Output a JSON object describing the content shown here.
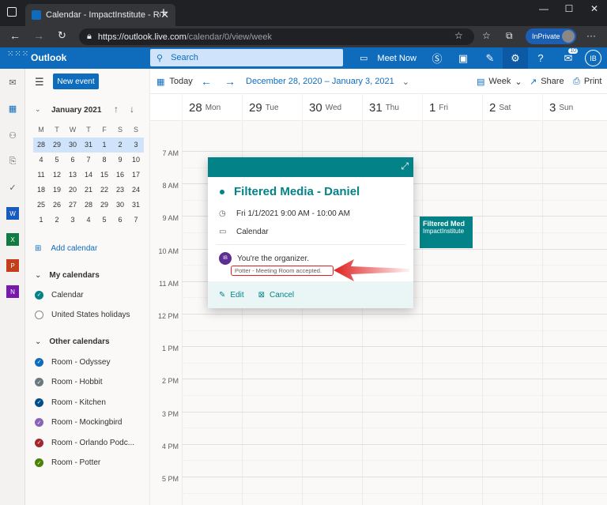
{
  "browser": {
    "tab_title": "Calendar - ImpactInstitute - Roo",
    "tab_close": "✕",
    "new_tab": "+",
    "url_host": "https://outlook.live.com",
    "url_path": "/calendar/0/view/week",
    "inprivate": "InPrivate",
    "menu": "···"
  },
  "header": {
    "app_name": "Outlook",
    "search_placeholder": "Search",
    "meet_now": "Meet Now",
    "badge_count": "10",
    "avatar": "IB",
    "help": "?"
  },
  "sidebar": {
    "new_event": "New event",
    "month_label": "January 2021",
    "weekday_headers": [
      "M",
      "T",
      "W",
      "T",
      "F",
      "S",
      "S"
    ],
    "weeks": [
      [
        "28",
        "29",
        "30",
        "31",
        "1",
        "2",
        "3"
      ],
      [
        "4",
        "5",
        "6",
        "7",
        "8",
        "9",
        "10"
      ],
      [
        "11",
        "12",
        "13",
        "14",
        "15",
        "16",
        "17"
      ],
      [
        "18",
        "19",
        "20",
        "21",
        "22",
        "23",
        "24"
      ],
      [
        "25",
        "26",
        "27",
        "28",
        "29",
        "30",
        "31"
      ],
      [
        "1",
        "2",
        "3",
        "4",
        "5",
        "6",
        "7"
      ]
    ],
    "add_calendar": "Add calendar",
    "my_calendars_title": "My calendars",
    "my_calendars": [
      {
        "label": "Calendar",
        "color": "#038387",
        "checked": true
      },
      {
        "label": "United States holidays",
        "color": "#ffffff",
        "checked": false
      }
    ],
    "other_calendars_title": "Other calendars",
    "other_calendars": [
      {
        "label": "Room - Odyssey",
        "color": "#0f6cbd",
        "checked": true
      },
      {
        "label": "Room - Hobbit",
        "color": "#69797e",
        "checked": true
      },
      {
        "label": "Room - Kitchen",
        "color": "#004e8c",
        "checked": true
      },
      {
        "label": "Room - Mockingbird",
        "color": "#8764b8",
        "checked": true
      },
      {
        "label": "Room - Orlando Podc...",
        "color": "#a4262c",
        "checked": true
      },
      {
        "label": "Room - Potter",
        "color": "#498205",
        "checked": true
      }
    ]
  },
  "command_bar": {
    "today": "Today",
    "date_range": "December 28, 2020 – January 3, 2021",
    "view": "Week",
    "share": "Share",
    "print": "Print"
  },
  "days": [
    {
      "num": "28",
      "name": "Mon"
    },
    {
      "num": "29",
      "name": "Tue"
    },
    {
      "num": "30",
      "name": "Wed"
    },
    {
      "num": "31",
      "name": "Thu"
    },
    {
      "num": "1",
      "name": "Fri"
    },
    {
      "num": "2",
      "name": "Sat"
    },
    {
      "num": "3",
      "name": "Sun"
    }
  ],
  "hours": [
    "7 AM",
    "8 AM",
    "9 AM",
    "10 AM",
    "11 AM",
    "12 PM",
    "1 PM",
    "2 PM",
    "3 PM",
    "4 PM",
    "5 PM"
  ],
  "event_block": {
    "title": "Filtered Med",
    "subtitle": "ImpactInstitute"
  },
  "popup": {
    "title": "Filtered Media - Daniel",
    "datetime": "Fri 1/1/2021 9:00 AM - 10:00 AM",
    "calendar": "Calendar",
    "avatar": "IB",
    "organizer_text": "You're the organizer.",
    "accepted_text": "Potter - Meeting Room accepted.",
    "edit": "Edit",
    "cancel": "Cancel"
  },
  "colors": {
    "brand": "#0f6cbd",
    "teal": "#038387",
    "highlight": "#e02020"
  }
}
